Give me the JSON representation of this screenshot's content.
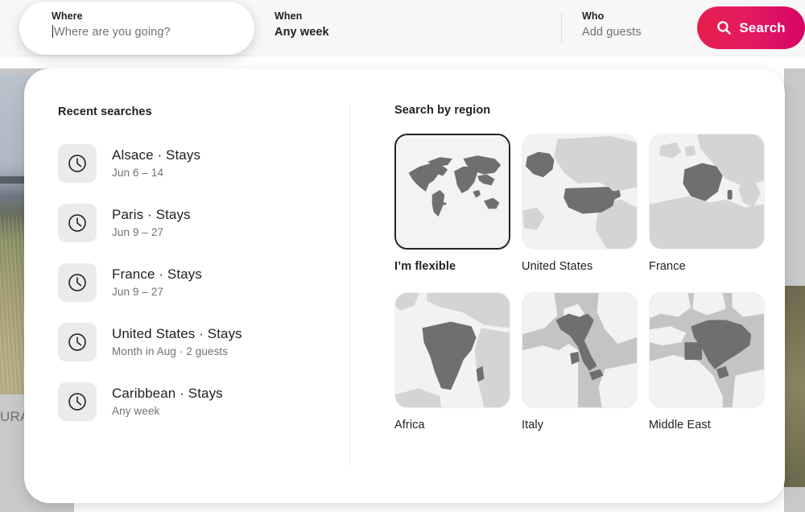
{
  "searchbar": {
    "where": {
      "label": "Where",
      "placeholder": "Where are you going?",
      "value": ""
    },
    "when": {
      "label": "When",
      "value": "Any week"
    },
    "who": {
      "label": "Who",
      "value": "Add guests"
    },
    "search_button": {
      "label": "Search",
      "icon": "search-icon"
    },
    "accent_color": "#e31c5f"
  },
  "background": {
    "caption": "URA"
  },
  "panel": {
    "recent": {
      "title": "Recent searches",
      "items": [
        {
          "icon": "clock-icon",
          "title": "Alsace · Stays",
          "subtitle": "Jun 6 – 14"
        },
        {
          "icon": "clock-icon",
          "title": "Paris · Stays",
          "subtitle": "Jun 9 – 27"
        },
        {
          "icon": "clock-icon",
          "title": "France · Stays",
          "subtitle": "Jun 9 – 27"
        },
        {
          "icon": "clock-icon",
          "title": "United States · Stays",
          "subtitle": "Month in Aug · 2 guests"
        },
        {
          "icon": "clock-icon",
          "title": "Caribbean · Stays",
          "subtitle": "Any week"
        }
      ]
    },
    "regions": {
      "title": "Search by region",
      "selected_index": 0,
      "items": [
        {
          "label": "I’m flexible",
          "map": "world",
          "selected": true
        },
        {
          "label": "United States",
          "map": "usa",
          "selected": false
        },
        {
          "label": "France",
          "map": "france",
          "selected": false
        },
        {
          "label": "Africa",
          "map": "africa",
          "selected": false
        },
        {
          "label": "Italy",
          "map": "italy",
          "selected": false
        },
        {
          "label": "Middle East",
          "map": "middle-east",
          "selected": false
        }
      ]
    }
  }
}
